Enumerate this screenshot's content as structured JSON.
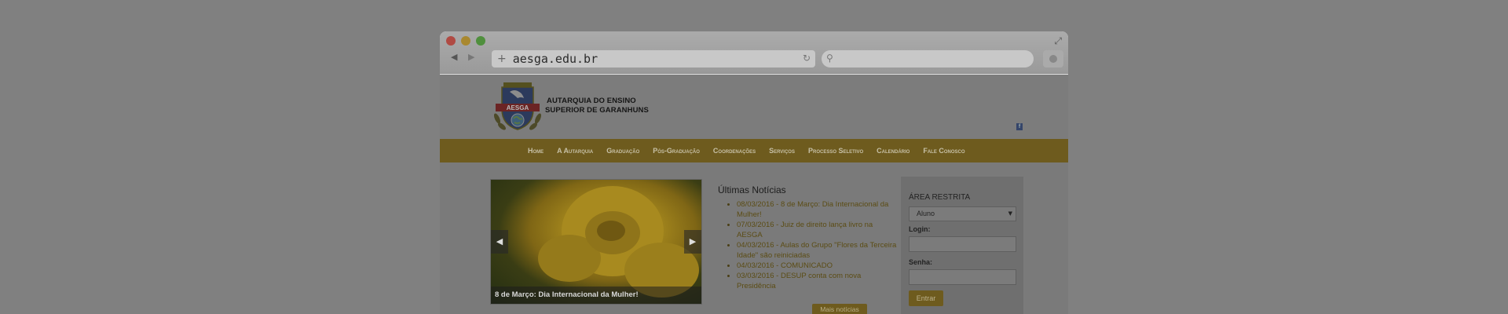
{
  "browser": {
    "url": "aesga.edu.br",
    "url_plus_icon": "plus-icon",
    "back_icon": "◀",
    "forward_icon": "▶",
    "reload_icon": "↻",
    "search_icon": "⚲",
    "expand_icon": "⤢"
  },
  "site": {
    "logo_text": "AESGA",
    "org_line1": "AUTARQUIA DO ENSINO",
    "org_line2": "SUPERIOR DE GARANHUNS",
    "social_icon": "f"
  },
  "menu": {
    "items": [
      "Home",
      "A Autarquia",
      "Graduação",
      "Pós-Graduação",
      "Coordenações",
      "Serviços",
      "Processo Seletivo",
      "Calendário",
      "Fale Conosco"
    ]
  },
  "slider": {
    "caption": "8 de Março: Dia Internacional da Mulher!",
    "prev": "◀",
    "next": "▶"
  },
  "news": {
    "title": "Últimas Notícias",
    "items": [
      "08/03/2016 - 8 de Março: Dia Internacional da Mulher!",
      "07/03/2016 - Juiz de direito lança livro na AESGA",
      "04/03/2016 - Aulas do Grupo \"Flores da Terceira Idade\" são reiniciadas",
      "04/03/2016 - COMUNICADO",
      "03/03/2016 - DESUP conta com nova Presidência"
    ],
    "more_label": "Mais notícias"
  },
  "restricted": {
    "title": "ÁREA RESTRITA",
    "select_value": "Aluno",
    "login_label": "Login:",
    "password_label": "Senha:",
    "submit_label": "Entrar"
  },
  "colors": {
    "menu_bg": "#6e5b1e",
    "overlay_bg": "#808080",
    "news_link": "#5b4c14"
  }
}
